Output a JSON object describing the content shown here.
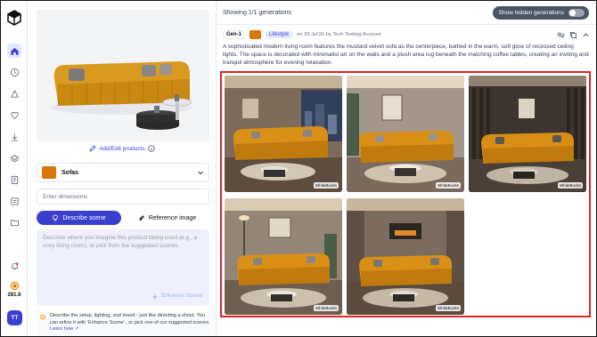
{
  "rail": {
    "credits": "281.8",
    "avatar": "TT",
    "icons": [
      "logo-icon",
      "home-icon",
      "history-icon",
      "template-icon",
      "heart-icon",
      "download-icon",
      "layers-icon",
      "billing-icon",
      "document-icon",
      "folder-icon",
      "bell-icon",
      "credits-icon"
    ]
  },
  "panel": {
    "add_edit_label": "Add/Edit products",
    "product_category": "Sofas",
    "dimensions_placeholder": "Enter dimensions",
    "tab_describe": "Describe scene",
    "tab_reference": "Reference image",
    "scene_placeholder": "Describe where you imagine this product being used (e.g., a cozy living room), or pick from the suggested scenes.",
    "enhance_label": "Enhance Scene",
    "hint_text": "Describe the setup, lighting, and mood - just like directing a shoot. You can refine it with 'Enhance Scene' , or pick one of our suggested scenes.",
    "learn_how": "Learn how"
  },
  "main": {
    "showing": "Showing 1/1 generations",
    "toggle_label": "Show hidden generations",
    "toggle_on": false,
    "gen_badge": "Gen-1",
    "gen_tag": "Lifestyle",
    "gen_meta": "on 29 Jul'26 by Tech Testing Account",
    "description": "A sophisticated modern living room features the mustard velvet sofa as the centerpiece, bathed in the warm, soft glow of recessed ceiling lights. The space is decorated with minimalist art on the walls and a plush area rug beneath the matching coffee tables, creating an inviting and tranquil atmosphere for evening relaxation.",
    "watermark": "WhiteBooks",
    "images": [
      {
        "name": "generated-image-1",
        "scene": "window-city-view"
      },
      {
        "name": "generated-image-2",
        "scene": "art-wall-plants"
      },
      {
        "name": "generated-image-3",
        "scene": "dark-wood-panels"
      },
      {
        "name": "generated-image-4",
        "scene": "floor-lamp-plant"
      },
      {
        "name": "generated-image-5",
        "scene": "fireplace-wall"
      }
    ]
  },
  "colors": {
    "accent": "#3b3fce",
    "sofa": "#d97706",
    "highlight_border": "#dc2626"
  }
}
